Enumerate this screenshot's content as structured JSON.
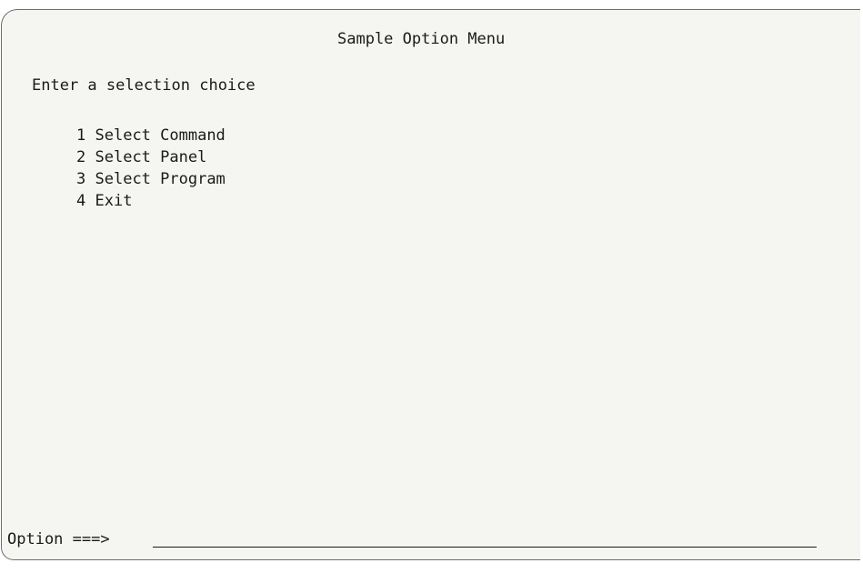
{
  "screen": {
    "title": "Sample Option Menu",
    "prompt": "Enter a selection choice",
    "options": [
      {
        "number": "1",
        "label": "Select Command"
      },
      {
        "number": "2",
        "label": "Select Panel"
      },
      {
        "number": "3",
        "label": "Select Program"
      },
      {
        "number": "4",
        "label": "Exit"
      }
    ],
    "command_line": {
      "label": "Option ===>",
      "value": ""
    }
  }
}
